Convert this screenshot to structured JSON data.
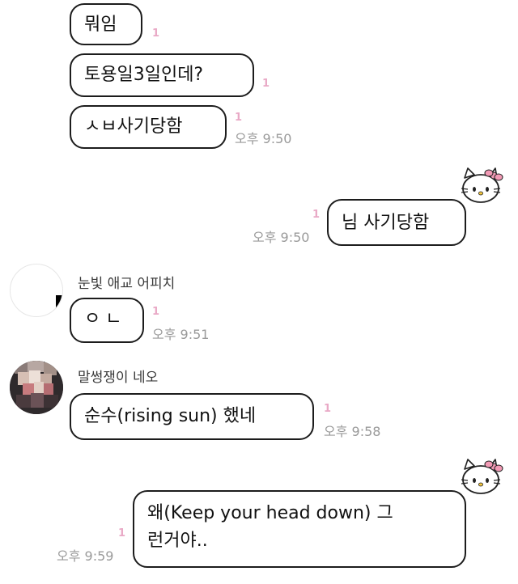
{
  "colors": {
    "unread_badge": "#e9a9c6",
    "timestamp": "#9a9a9a",
    "bubble_border": "#1c1c1c",
    "background": "#ffffff"
  },
  "messages": {
    "m1": {
      "text": "뭐임",
      "unread": "1"
    },
    "m2": {
      "text": "토용일3일인데?",
      "unread": "1"
    },
    "m3": {
      "text": "ㅅㅂ사기당함",
      "unread": "1",
      "time": "오후 9:50"
    },
    "m4": {
      "text": "님 사기당함",
      "unread": "1",
      "time": "오후 9:50"
    },
    "m5": {
      "sender": "눈빛 애교 어피치",
      "text": "ㅇㄴ",
      "unread": "1",
      "time": "오후 9:51"
    },
    "m6": {
      "sender": "말썽쟁이 네오",
      "text": "순수(rising sun) 했네",
      "unread": "1",
      "time": "오후 9:58"
    },
    "m7": {
      "text_line1": "왜(Keep your head down) 그",
      "text_line2": "런거야..",
      "unread": "1",
      "time": "오후 9:59"
    }
  },
  "icons": {
    "my_avatar": "hello-kitty-icon",
    "apeach_avatar": "empty-profile",
    "neo_avatar": "blurred-photo"
  }
}
